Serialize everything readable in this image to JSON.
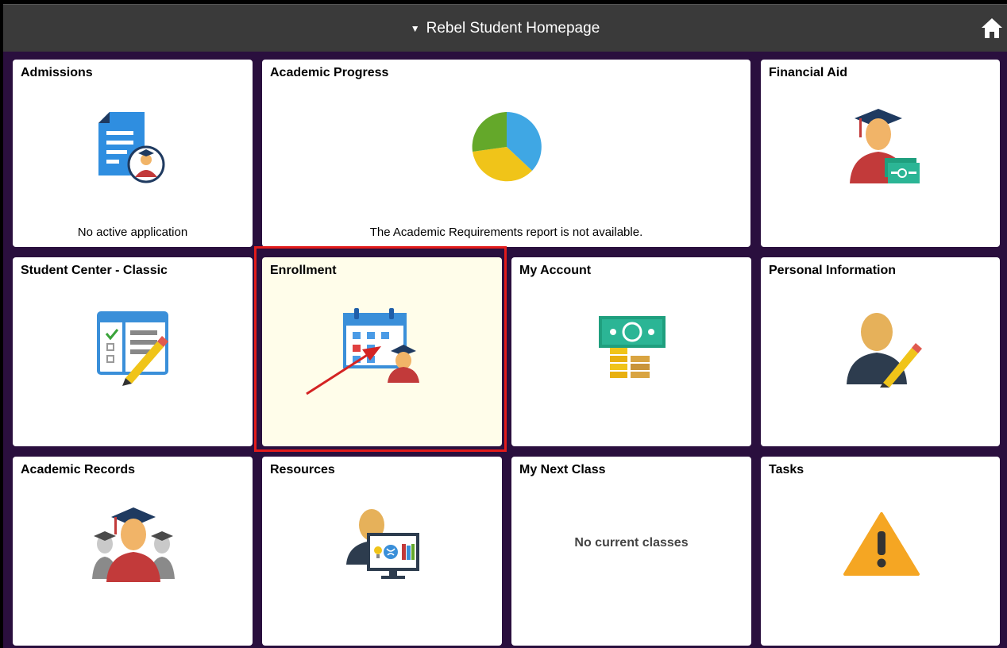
{
  "header": {
    "title": "Rebel Student Homepage"
  },
  "tiles": {
    "admissions": {
      "title": "Admissions",
      "footer": "No active application"
    },
    "academic_progress": {
      "title": "Academic Progress",
      "footer": "The Academic Requirements report is not available."
    },
    "financial_aid": {
      "title": "Financial Aid"
    },
    "student_center": {
      "title": "Student Center - Classic"
    },
    "enrollment": {
      "title": "Enrollment"
    },
    "my_account": {
      "title": "My Account"
    },
    "personal_information": {
      "title": "Personal Information"
    },
    "academic_records": {
      "title": "Academic Records"
    },
    "resources": {
      "title": "Resources"
    },
    "my_next_class": {
      "title": "My Next Class",
      "message": "No current classes"
    },
    "tasks": {
      "title": "Tasks"
    }
  },
  "colors": {
    "grid_background": "#2a0f3e",
    "header_background": "#3a3a3a",
    "selected_tile": "#fffdea",
    "highlight": "#e21b1b"
  },
  "icons": {
    "home": "home-icon",
    "admissions": "document-student-icon",
    "academic_progress": "pie-chart-icon",
    "financial_aid": "graduate-money-icon",
    "student_center": "checklist-pencil-icon",
    "enrollment": "calendar-student-icon",
    "my_account": "money-coins-icon",
    "personal_information": "person-pencil-icon",
    "academic_records": "graduates-group-icon",
    "resources": "teacher-screen-icon",
    "tasks": "warning-icon"
  }
}
